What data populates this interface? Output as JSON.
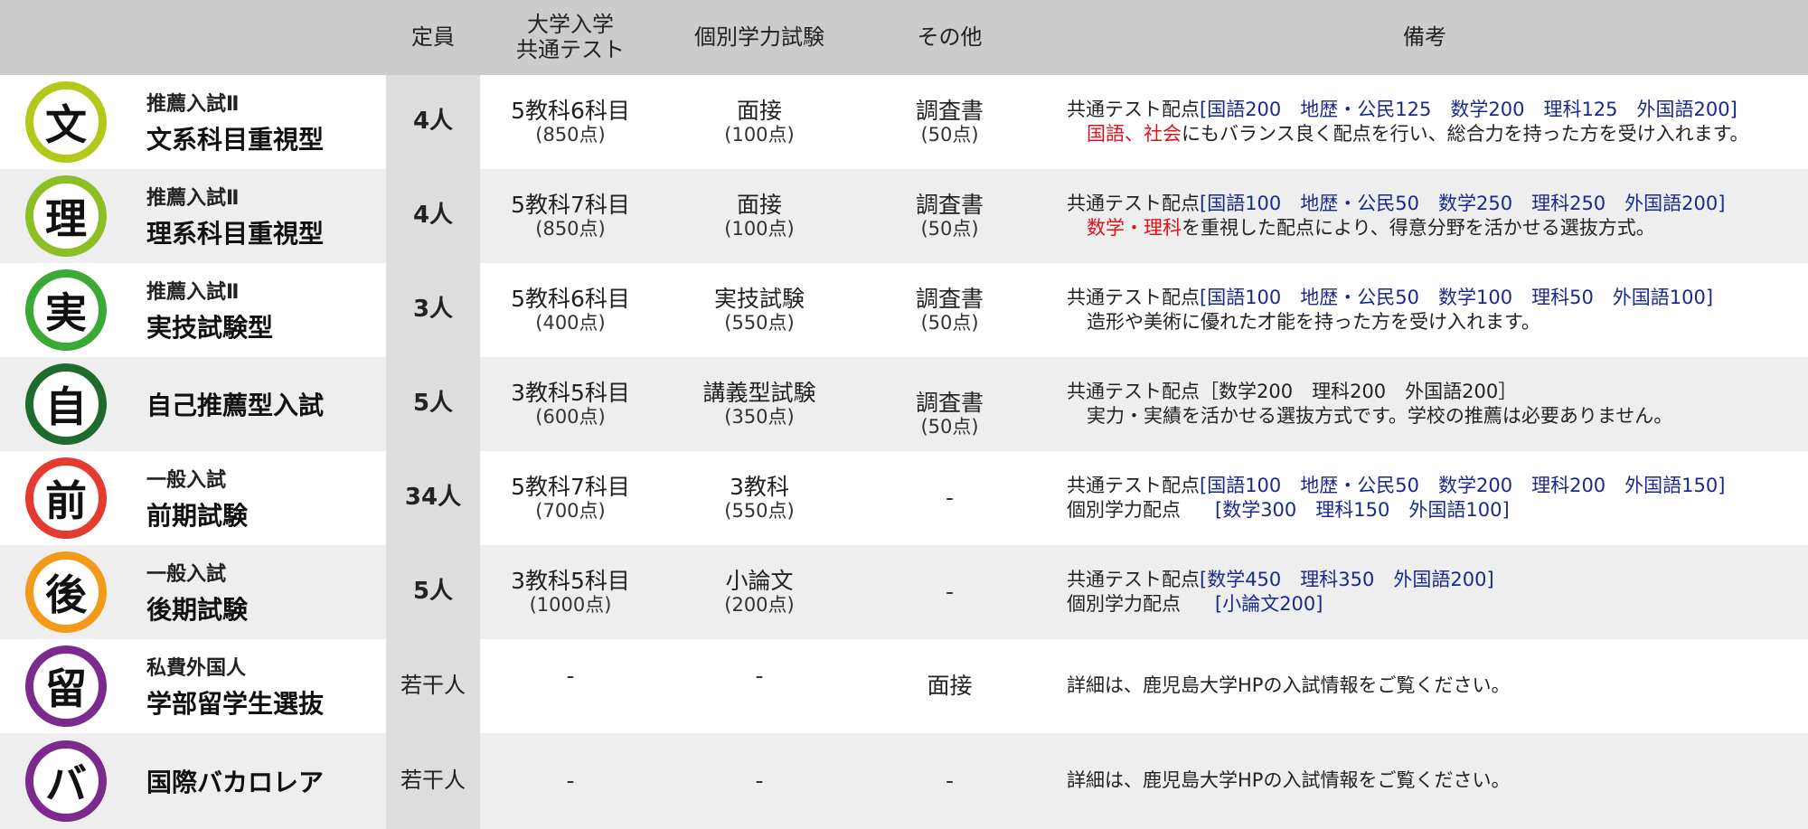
{
  "header": {
    "capacity": "定員",
    "common_test_line1": "大学入学",
    "common_test_line2": "共通テスト",
    "individual": "個別学力試験",
    "other": "その他",
    "remarks": "備考"
  },
  "rows": [
    {
      "badge": "文",
      "badge_color": "#b3c91a",
      "small": "推薦入試Ⅱ",
      "big": "文系科目重視型",
      "capacity": "4人",
      "common_main": "5教科6科目",
      "common_sub": "(850点)",
      "individual_main": "面接",
      "individual_sub": "(100点)",
      "other_main": "調査書",
      "other_sub": "(50点)",
      "note_label": "共通テスト配点",
      "note_scores": "[国語200　地歴・公民125　数学200　理科125　外国語200]",
      "note_red": "国語、社会",
      "note_rest": "にもバランス良く配点を行い、総合力を持った方を受け入れます。"
    },
    {
      "badge": "理",
      "badge_color": "#8cbf26",
      "small": "推薦入試Ⅱ",
      "big": "理系科目重視型",
      "capacity": "4人",
      "common_main": "5教科7科目",
      "common_sub": "(850点)",
      "individual_main": "面接",
      "individual_sub": "(100点)",
      "other_main": "調査書",
      "other_sub": "(50点)",
      "note_label": "共通テスト配点",
      "note_scores": "[国語100　地歴・公民50　数学250　理科250　外国語200]",
      "note_red": "数学・理科",
      "note_rest": "を重視した配点により、得意分野を活かせる選抜方式。"
    },
    {
      "badge": "実",
      "badge_color": "#3aa935",
      "small": "推薦入試Ⅱ",
      "big": "実技試験型",
      "capacity": "3人",
      "common_main": "5教科6科目",
      "common_sub": "(400点)",
      "individual_main": "実技試験",
      "individual_sub": "(550点)",
      "other_main": "調査書",
      "other_sub": "(50点)",
      "note_label": "共通テスト配点",
      "note_scores": "[国語100　地歴・公民50　数学100　理科50　外国語100]",
      "note_line2": "造形や美術に優れた才能を持った方を受け入れます。"
    },
    {
      "badge": "自",
      "badge_color": "#1f6b2e",
      "big": "自己推薦型入試",
      "capacity": "5人",
      "common_main": "3教科5科目",
      "common_sub": "(600点)",
      "individual_main": "講義型試験",
      "individual_sub": "(350点)",
      "other_main": "調査書",
      "other_sub": "(50点)",
      "note_line1": "共通テスト配点［数学200　理科200　外国語200］",
      "note_line2": "実力・実績を活かせる選抜方式です。学校の推薦は必要ありません。"
    },
    {
      "badge": "前",
      "badge_color": "#e53a2f",
      "small": "一般入試",
      "big": "前期試験",
      "capacity": "34人",
      "common_main": "5教科7科目",
      "common_sub": "(700点)",
      "individual_main": "3教科",
      "individual_sub": "(550点)",
      "other_main": "-",
      "note_label": "共通テスト配点",
      "note_scores": "[国語100　地歴・公民50　数学200　理科200　外国語150]",
      "note_label2": "個別学力配点",
      "note_scores2": "[数学300　理科150　外国語100]"
    },
    {
      "badge": "後",
      "badge_color": "#f39a1a",
      "small": "一般入試",
      "big": "後期試験",
      "capacity": "5人",
      "common_main": "3教科5科目",
      "common_sub": "(1000点)",
      "individual_main": "小論文",
      "individual_sub": "(200点)",
      "other_main": "-",
      "note_label": "共通テスト配点",
      "note_scores": "[数学450　理科350　外国語200]",
      "note_label2": "個別学力配点",
      "note_scores2": "[小論文200]"
    },
    {
      "badge": "留",
      "badge_color": "#7b2b8c",
      "small": "私費外国人",
      "big": "学部留学生選抜",
      "capacity": "若干人",
      "common_main": "-",
      "individual_main": "-",
      "other_main": "面接",
      "note_line1": "詳細は、鹿児島大学HPの入試情報をご覧ください。"
    },
    {
      "badge": "バ",
      "badge_color": "#7b2b8c",
      "big": "国際バカロレア",
      "capacity": "若干人",
      "common_main": "-",
      "individual_main": "-",
      "other_main": "-",
      "note_line1": "詳細は、鹿児島大学HPの入試情報をご覧ください。"
    }
  ]
}
